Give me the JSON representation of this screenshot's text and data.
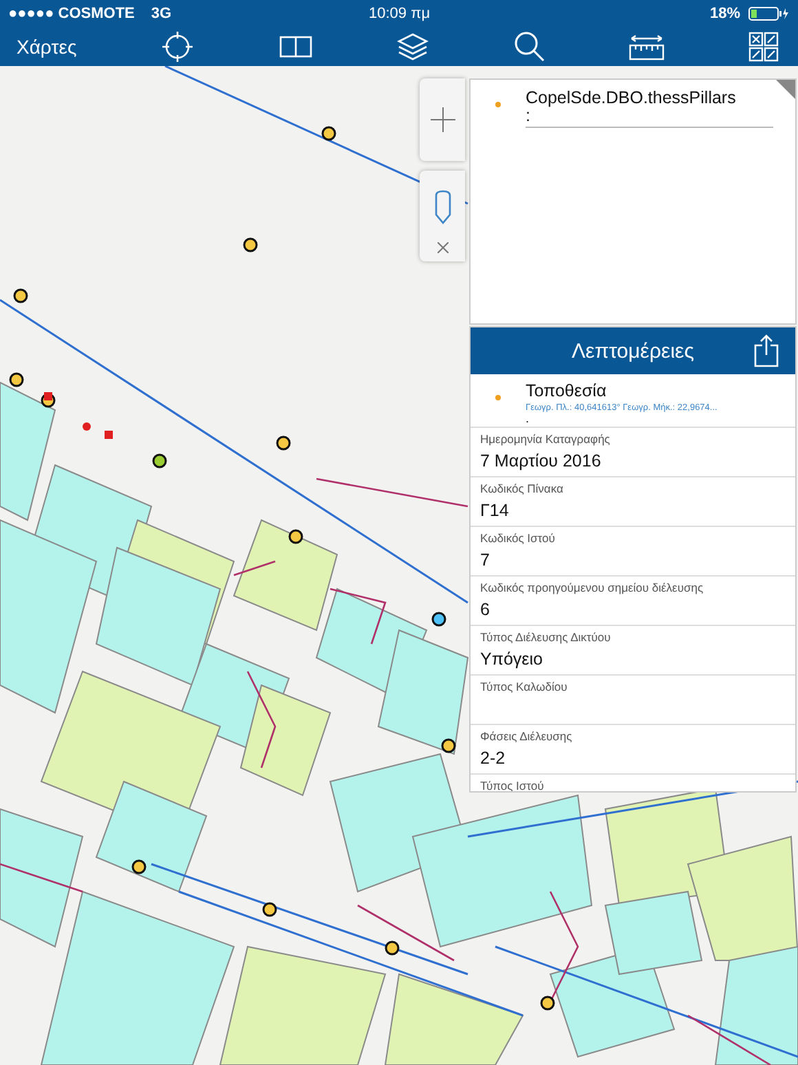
{
  "status_bar": {
    "carrier": "●●●●● COSMOTE",
    "network": "3G",
    "time": "10:09 πμ",
    "battery": "18%"
  },
  "toolbar": {
    "back_label": "Χάρτες"
  },
  "popup": {
    "title": "CopelSde.DBO.thessPillars",
    "subtitle": ":"
  },
  "details": {
    "title": "Λεπτομέρειες",
    "location": {
      "label": "Τοποθεσία",
      "coords": "Γεωγρ. Πλ.: 40,641613° Γεωγρ. Μήκ.: 22,9674...",
      "extra": "."
    },
    "fields": [
      {
        "label": "Ημερομηνία Καταγραφής",
        "value": "7 Μαρτίου 2016"
      },
      {
        "label": "Κωδικός Πίνακα",
        "value": "Γ14"
      },
      {
        "label": "Κωδικός Ιστού",
        "value": "7"
      },
      {
        "label": "Κωδικός προηγούμενου σημείου διέλευσης",
        "value": "6"
      },
      {
        "label": "Τύπος Διέλευσης Δικτύου",
        "value": "Υπόγειο"
      },
      {
        "label": "Τύπος Καλωδίου"
      },
      {
        "label": "Φάσεις Διέλευσης",
        "value": "2-2"
      },
      {
        "label": "Τύπος Ιστού"
      }
    ]
  }
}
